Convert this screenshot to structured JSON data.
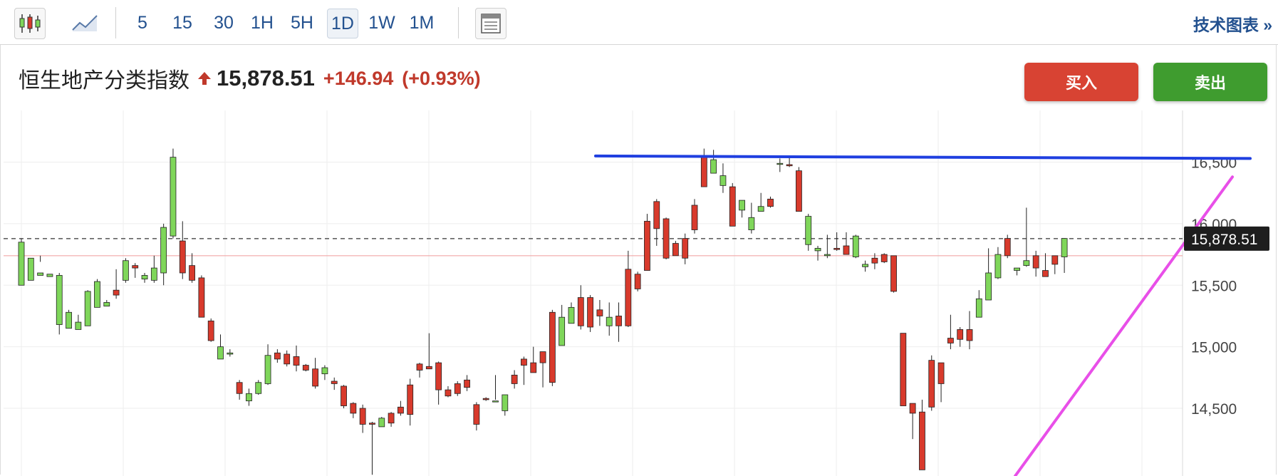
{
  "toolbar": {
    "candle_icon": "candlestick-icon",
    "line_icon": "line-chart-icon",
    "intervals": [
      "5",
      "15",
      "30",
      "1H",
      "5H",
      "1D",
      "1W",
      "1M"
    ],
    "selected_interval": "1D",
    "layout_icon": "layout-icon",
    "tech_chart_label": "技术图表 »"
  },
  "header": {
    "index_name": "恒生地产分类指数",
    "price": "15,878.51",
    "change": "+146.94",
    "change_pct": "(+0.93%)",
    "up_color": "#c0392b"
  },
  "actions": {
    "buy_label": "买入",
    "sell_label": "卖出"
  },
  "chart_data": {
    "type": "candlestick",
    "y_ticks": [
      "16,500",
      "16,000",
      "15,500",
      "15,000",
      "14,500"
    ],
    "y_tick_values": [
      16500,
      16000,
      15500,
      15000,
      14500
    ],
    "ylim": [
      13950,
      16920
    ],
    "last_price": 15878.51,
    "last_price_label": "15,878.51",
    "reference_level": 15740,
    "up_color": "#7fd65a",
    "down_color": "#d83a2c",
    "candles": [
      [
        15560,
        15880,
        15500,
        15850
      ],
      [
        15580,
        15700,
        15540,
        15720
      ],
      [
        15740,
        15690,
        15580,
        15600
      ],
      [
        15600,
        15600,
        15570,
        15590
      ],
      [
        15100,
        15600,
        15180,
        15580
      ],
      [
        15150,
        15300,
        15150,
        15280
      ],
      [
        15140,
        15260,
        15140,
        15200
      ],
      [
        15210,
        15460,
        15170,
        15450
      ],
      [
        15320,
        15550,
        15320,
        15530
      ],
      [
        15360,
        15380,
        15330,
        15360
      ],
      [
        15390,
        15630,
        15460,
        15420
      ],
      [
        15520,
        15720,
        15540,
        15700
      ],
      [
        15560,
        15680,
        15660,
        15640
      ],
      [
        15520,
        15600,
        15550,
        15580
      ],
      [
        15520,
        15740,
        15540,
        15640
      ],
      [
        15500,
        16000,
        15600,
        15970
      ],
      [
        15880,
        16610,
        15900,
        16540
      ],
      [
        15550,
        16020,
        15860,
        15600
      ],
      [
        15520,
        15760,
        15660,
        15540
      ],
      [
        15240,
        15580,
        15560,
        15240
      ],
      [
        15040,
        15230,
        15210,
        15050
      ],
      [
        14900,
        15100,
        14900,
        15000
      ],
      [
        14920,
        14980,
        14940,
        14950
      ],
      [
        14570,
        14730,
        14710,
        14620
      ],
      [
        14520,
        14660,
        14560,
        14620
      ],
      [
        14610,
        14730,
        14620,
        14710
      ],
      [
        14690,
        15020,
        14700,
        14930
      ],
      [
        14870,
        14980,
        14950,
        14900
      ],
      [
        14840,
        14970,
        14940,
        14860
      ],
      [
        14800,
        15010,
        14920,
        14850
      ],
      [
        14800,
        14860,
        14850,
        14810
      ],
      [
        14660,
        14910,
        14820,
        14680
      ],
      [
        14730,
        14850,
        14780,
        14830
      ],
      [
        14650,
        14750,
        14720,
        14700
      ],
      [
        14500,
        14690,
        14680,
        14520
      ],
      [
        14420,
        14550,
        14540,
        14460
      ],
      [
        14300,
        14530,
        14500,
        14370
      ],
      [
        13960,
        14390,
        14380,
        14370
      ],
      [
        14360,
        14430,
        14350,
        14420
      ],
      [
        14350,
        14470,
        14460,
        14380
      ],
      [
        14440,
        14560,
        14510,
        14460
      ],
      [
        14360,
        14740,
        14690,
        14450
      ],
      [
        14750,
        14870,
        14860,
        14810
      ],
      [
        14830,
        15110,
        14840,
        14820
      ],
      [
        14530,
        14880,
        14870,
        14650
      ],
      [
        14590,
        14680,
        14650,
        14600
      ],
      [
        14600,
        14720,
        14700,
        14620
      ],
      [
        14640,
        14770,
        14730,
        14670
      ],
      [
        14320,
        14550,
        14530,
        14370
      ],
      [
        14560,
        14590,
        14580,
        14570
      ],
      [
        14570,
        14770,
        14560,
        14560
      ],
      [
        14440,
        14610,
        14480,
        14610
      ],
      [
        14660,
        14810,
        14770,
        14700
      ],
      [
        14690,
        14920,
        14900,
        14850
      ],
      [
        14800,
        15000,
        14870,
        14790
      ],
      [
        14670,
        14950,
        14960,
        14870
      ],
      [
        14680,
        15300,
        15280,
        14710
      ],
      [
        15020,
        15340,
        15010,
        15240
      ],
      [
        15190,
        15360,
        15190,
        15320
      ],
      [
        15140,
        15500,
        15400,
        15170
      ],
      [
        15120,
        15420,
        15400,
        15160
      ],
      [
        15170,
        15380,
        15300,
        15250
      ],
      [
        15090,
        15360,
        15170,
        15240
      ],
      [
        15040,
        15360,
        15250,
        15170
      ],
      [
        15160,
        15780,
        15630,
        15170
      ],
      [
        15450,
        15610,
        15590,
        15470
      ],
      [
        15620,
        16080,
        16020,
        15620
      ],
      [
        15820,
        16200,
        16180,
        15960
      ],
      [
        15710,
        16050,
        16040,
        15720
      ],
      [
        15780,
        15860,
        15840,
        15740
      ],
      [
        15670,
        15920,
        15880,
        15720
      ],
      [
        15920,
        16200,
        16150,
        15950
      ],
      [
        16320,
        16610,
        16550,
        16300
      ],
      [
        16450,
        16600,
        16410,
        16520
      ],
      [
        16250,
        16490,
        16310,
        16390
      ],
      [
        16080,
        16330,
        16300,
        15980
      ],
      [
        16050,
        16180,
        16110,
        16190
      ],
      [
        15920,
        16170,
        15950,
        16050
      ],
      [
        16100,
        16250,
        16100,
        16140
      ],
      [
        16130,
        16220,
        16200,
        16140
      ],
      [
        16420,
        16530,
        16490,
        16490
      ],
      [
        16460,
        16540,
        16480,
        16470
      ],
      [
        16420,
        16460,
        16430,
        16100
      ],
      [
        15780,
        16080,
        15830,
        16060
      ],
      [
        15700,
        15820,
        15780,
        15800
      ],
      [
        15720,
        15910,
        15740,
        15750
      ],
      [
        15780,
        15930,
        15800,
        15790
      ],
      [
        15760,
        15930,
        15820,
        15750
      ],
      [
        15720,
        15910,
        15730,
        15900
      ],
      [
        15610,
        15700,
        15650,
        15670
      ],
      [
        15630,
        15760,
        15720,
        15680
      ],
      [
        15680,
        15760,
        15750,
        15690
      ],
      [
        15440,
        15740,
        15740,
        15450
      ],
      [
        14540,
        15100,
        15110,
        14520
      ],
      [
        14250,
        14540,
        14540,
        14460
      ],
      [
        14020,
        14570,
        14470,
        14000
      ],
      [
        14480,
        14930,
        14890,
        14510
      ],
      [
        14550,
        14870,
        14870,
        14700
      ],
      [
        14980,
        15260,
        15070,
        15030
      ],
      [
        15000,
        15160,
        15140,
        15060
      ],
      [
        14980,
        15290,
        15140,
        15050
      ],
      [
        15260,
        15460,
        15240,
        15390
      ],
      [
        15420,
        15800,
        15380,
        15600
      ],
      [
        15550,
        15810,
        15560,
        15750
      ],
      [
        15720,
        15910,
        15880,
        15740
      ],
      [
        15580,
        15640,
        15620,
        15640
      ],
      [
        15650,
        16130,
        15660,
        15700
      ],
      [
        15570,
        15780,
        15740,
        15640
      ],
      [
        15580,
        15760,
        15620,
        15570
      ],
      [
        15590,
        15740,
        15740,
        15670
      ],
      [
        15600,
        15810,
        15730,
        15880
      ]
    ]
  }
}
